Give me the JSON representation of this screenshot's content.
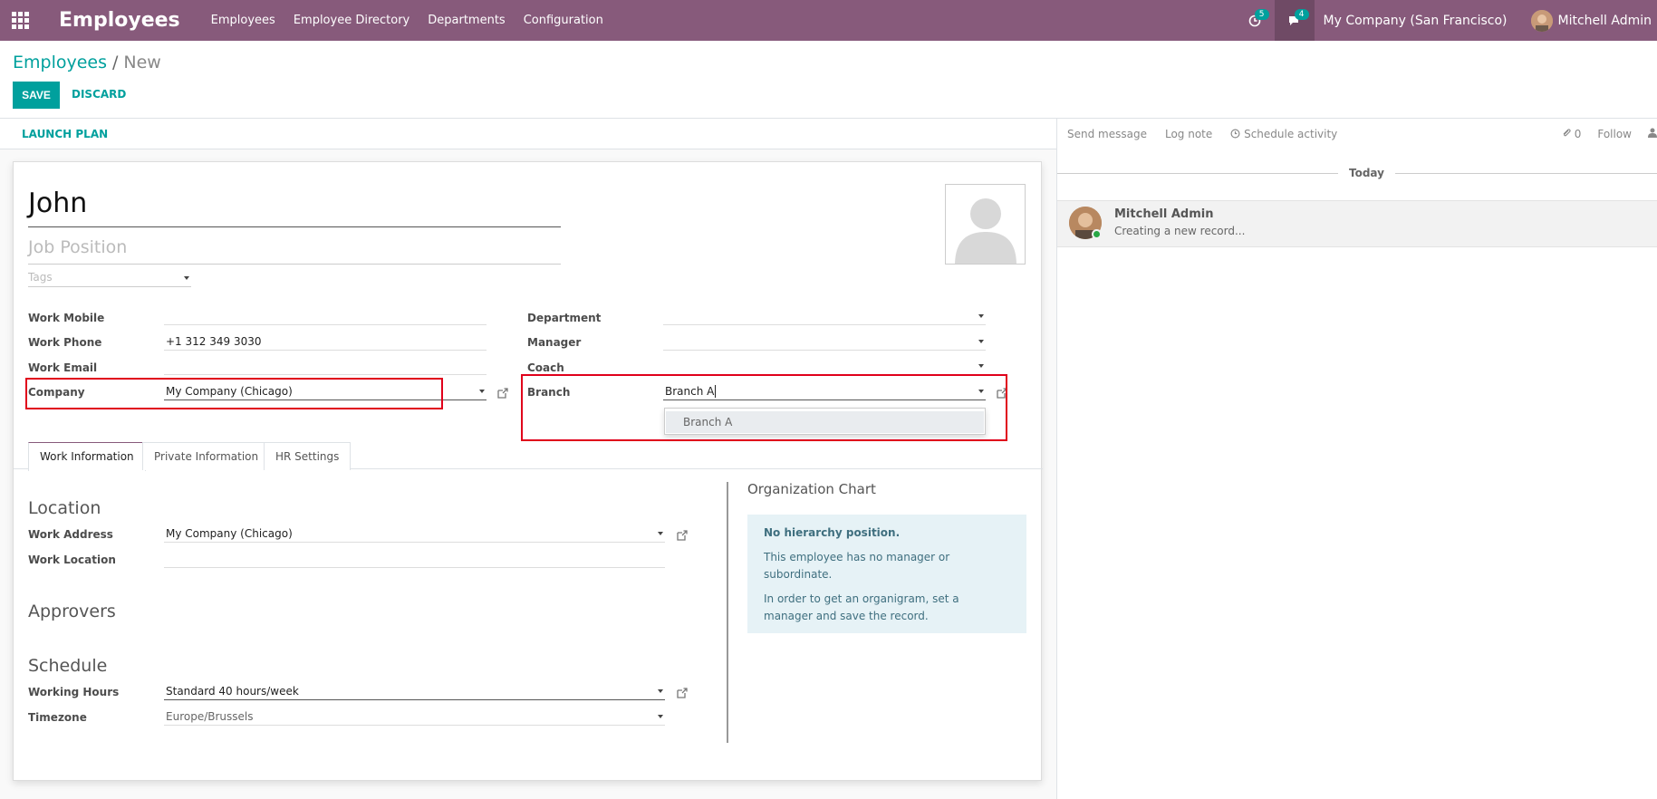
{
  "navbar": {
    "brand": "Employees",
    "menu": [
      "Employees",
      "Employee Directory",
      "Departments",
      "Configuration"
    ],
    "activity_count": "5",
    "message_count": "4",
    "company": "My Company (San Francisco)",
    "user": "Mitchell Admin"
  },
  "breadcrumb": {
    "parent": "Employees",
    "separator": "/",
    "current": "New"
  },
  "buttons": {
    "save": "SAVE",
    "discard": "DISCARD",
    "launch_plan": "LAUNCH PLAN"
  },
  "form": {
    "name": "John",
    "job_position_placeholder": "Job Position",
    "tags_placeholder": "Tags",
    "labels": {
      "work_mobile": "Work Mobile",
      "work_phone": "Work Phone",
      "work_email": "Work Email",
      "company": "Company",
      "department": "Department",
      "manager": "Manager",
      "coach": "Coach",
      "branch": "Branch"
    },
    "values": {
      "work_mobile": "",
      "work_phone": "+1 312 349 3030",
      "work_email": "",
      "company": "My Company (Chicago)",
      "department": "",
      "manager": "",
      "coach": "",
      "branch": "Branch A"
    },
    "branch_dropdown": [
      "Branch A"
    ]
  },
  "tabs": [
    "Work Information",
    "Private Information",
    "HR Settings"
  ],
  "work_info": {
    "location_title": "Location",
    "work_address_label": "Work Address",
    "work_address": "My Company (Chicago)",
    "work_location_label": "Work Location",
    "work_location": "",
    "approvers_title": "Approvers",
    "schedule_title": "Schedule",
    "working_hours_label": "Working Hours",
    "working_hours": "Standard 40 hours/week",
    "timezone_label": "Timezone",
    "timezone": "Europe/Brussels"
  },
  "org_chart": {
    "title": "Organization Chart",
    "heading": "No hierarchy position.",
    "line1": "This employee has no manager or subordinate.",
    "line2": "In order to get an organigram, set a manager and save the record."
  },
  "chatter": {
    "send_message": "Send message",
    "log_note": "Log note",
    "schedule_activity": "Schedule activity",
    "attachments": "0",
    "follow": "Follow",
    "today": "Today",
    "author": "Mitchell Admin",
    "body": "Creating a new record..."
  },
  "colors": {
    "brand": "#875a7b",
    "accent": "#00a09d",
    "highlight": "#e0001b"
  }
}
